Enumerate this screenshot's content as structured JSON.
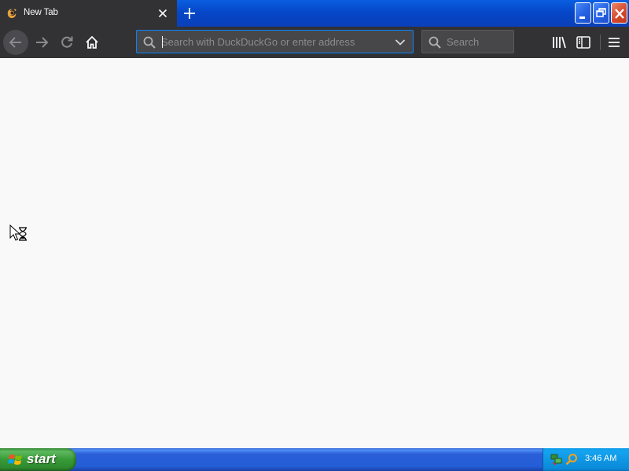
{
  "browser": {
    "tab": {
      "title": "New Tab",
      "favicon": "firefox-favicon"
    },
    "address_bar": {
      "placeholder": "Search with DuckDuckGo or enter address",
      "value": ""
    },
    "search_bar": {
      "placeholder": "Search",
      "value": ""
    },
    "icons": {
      "back": "arrow-left-icon",
      "forward": "arrow-right-icon",
      "reload": "reload-icon",
      "home": "home-icon",
      "library": "library-icon",
      "sidebar": "sidebar-icon",
      "menu": "hamburger-icon"
    },
    "colors": {
      "toolbar": "#323234",
      "urlbar_border": "#0a84ff",
      "content": "#f9f9fa"
    }
  },
  "taskbar": {
    "start_label": "start",
    "clock": "3:46 AM",
    "tray_icons": [
      "network-icon",
      "search-icon"
    ]
  }
}
